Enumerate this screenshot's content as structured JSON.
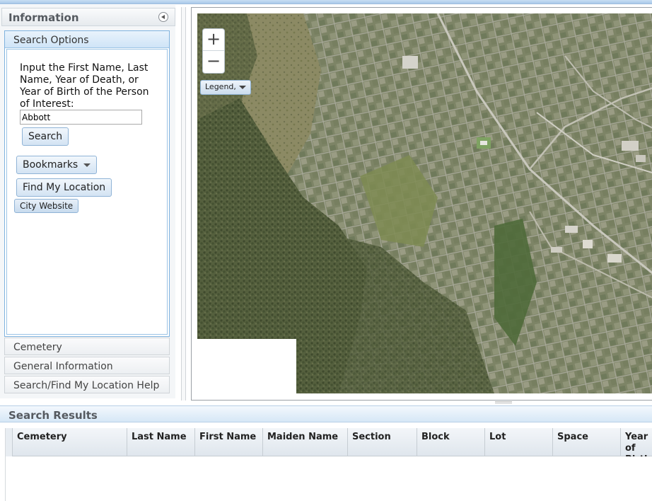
{
  "left_panel": {
    "title": "Information",
    "active_section": {
      "title": "Search Options",
      "instruction": "Input the First Name, Last Name, Year of Death, or Year of Birth of the Person of Interest:",
      "search_value": "Abbott",
      "search_button": "Search",
      "bookmarks_button": "Bookmarks",
      "find_location_button": "Find My Location",
      "city_website_button": "City Website"
    },
    "sections": [
      "Cemetery",
      "General Information",
      "Search/Find My Location Help"
    ]
  },
  "map": {
    "zoom_in": "+",
    "zoom_out": "−",
    "legend_button": "Legend,"
  },
  "results": {
    "title": "Search Results",
    "columns": [
      "Cemetery",
      "Last Name",
      "First Name",
      "Maiden Name",
      "Section",
      "Block",
      "Lot",
      "Space",
      "Year of Birth"
    ]
  },
  "icons": {
    "collapse": "collapse-left-icon",
    "dropdown": "caret-down-icon"
  },
  "colors": {
    "accent_border": "#7fb2de",
    "header_gradient_top": "#e9f3fc",
    "header_gradient_bottom": "#cfe4f7"
  }
}
